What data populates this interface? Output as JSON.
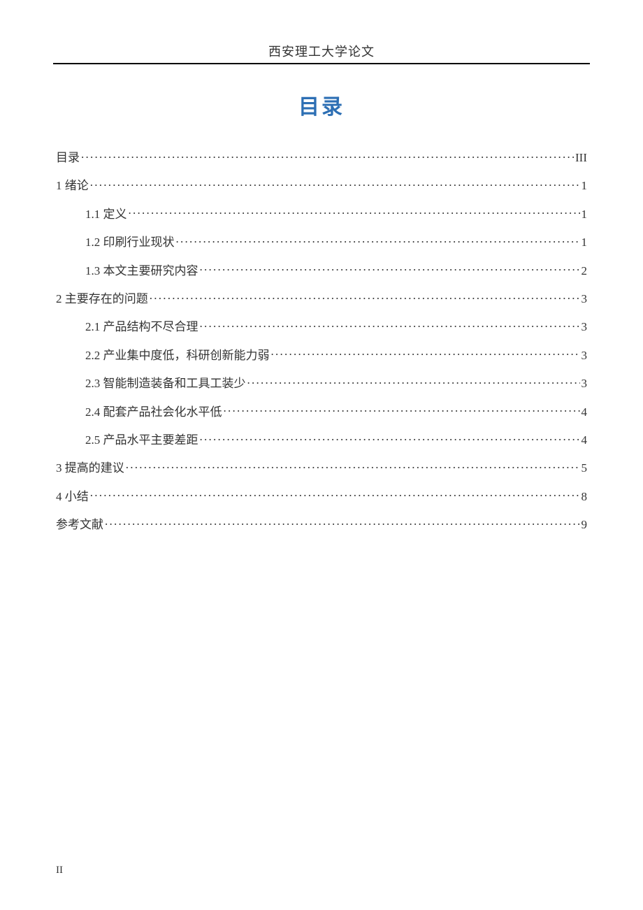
{
  "header": "西安理工大学论文",
  "title": "目录",
  "toc": [
    {
      "level": 1,
      "label": "目录",
      "page": "III"
    },
    {
      "level": 1,
      "label": "1 绪论",
      "page": "1"
    },
    {
      "level": 2,
      "label": "1.1 定义",
      "page": "1"
    },
    {
      "level": 2,
      "label": "1.2 印刷行业现状",
      "page": "1"
    },
    {
      "level": 2,
      "label": "1.3 本文主要研究内容",
      "page": "2"
    },
    {
      "level": 1,
      "label": "2 主要存在的问题",
      "page": "3"
    },
    {
      "level": 2,
      "label": "2.1 产品结构不尽合理",
      "page": "3"
    },
    {
      "level": 2,
      "label": "2.2 产业集中度低，科研创新能力弱",
      "page": "3"
    },
    {
      "level": 2,
      "label": "2.3 智能制造装备和工具工装少",
      "page": "3"
    },
    {
      "level": 2,
      "label": "2.4 配套产品社会化水平低",
      "page": "4"
    },
    {
      "level": 2,
      "label": "2.5 产品水平主要差距",
      "page": "4"
    },
    {
      "level": 1,
      "label": "3 提高的建议",
      "page": "5"
    },
    {
      "level": 1,
      "label": "4 小结",
      "page": "8"
    },
    {
      "level": 1,
      "label": "参考文献",
      "page": "9"
    }
  ],
  "page_number": "II"
}
